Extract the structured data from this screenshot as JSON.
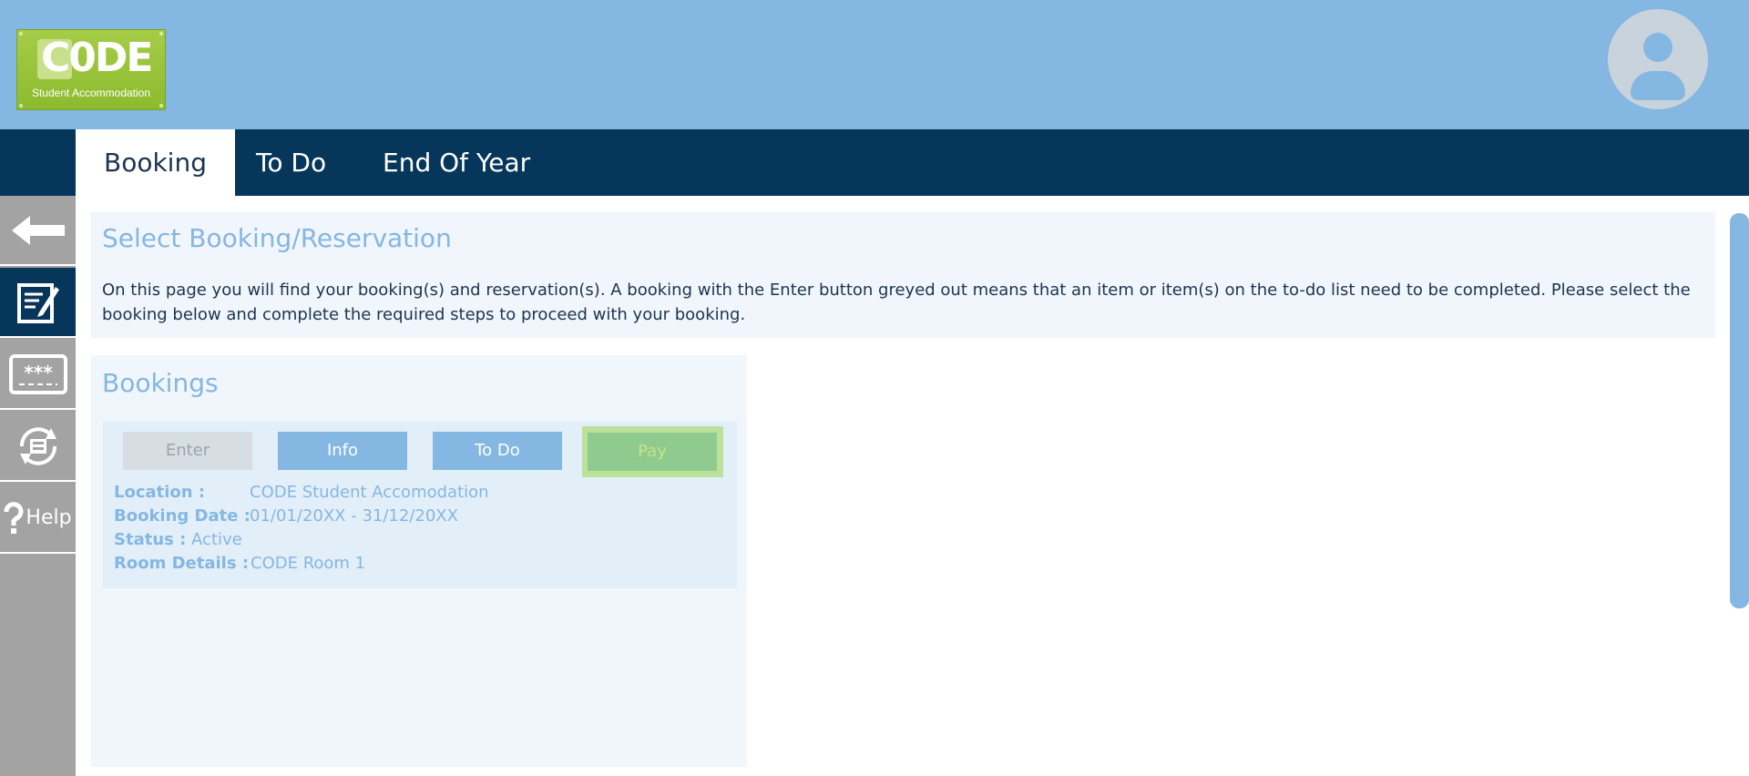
{
  "header": {
    "logo_text": "C0DE",
    "logo_tagline": "Student Accommodation"
  },
  "nav": {
    "tabs": [
      {
        "label": "Booking",
        "active": true
      },
      {
        "label": "To Do",
        "active": false
      },
      {
        "label": "End Of Year",
        "active": false
      }
    ]
  },
  "sidebar": {
    "items": [
      {
        "icon": "back-arrow-icon"
      },
      {
        "icon": "edit-document-icon",
        "active": true
      },
      {
        "icon": "password-icon"
      },
      {
        "icon": "refresh-print-icon"
      },
      {
        "icon": "help-icon",
        "label": "Help"
      }
    ]
  },
  "intro": {
    "title": "Select Booking/Reservation",
    "text": "On this page you will find your booking(s) and reservation(s). A booking with the Enter button greyed out means that an item or item(s) on the to-do list need to be completed. Please select the booking below and complete the required steps to proceed with your booking."
  },
  "bookings": {
    "title": "Bookings",
    "buttons": {
      "enter": "Enter",
      "info": "Info",
      "todo": "To Do",
      "pay": "Pay"
    },
    "details": {
      "location_label": "Location :",
      "location_value": "CODE Student Accomodation",
      "date_label": "Booking Date :",
      "date_value": "01/01/20XX - 31/12/20XX",
      "status_label": "Status :",
      "status_value": "Active",
      "room_label": "Room Details :",
      "room_value": "CODE Room 1"
    }
  },
  "colors": {
    "header_bg": "#84b7e2",
    "nav_bg": "#06365a",
    "sidebar_bg": "#a3a3a3",
    "logo_green": "#a6cc48",
    "accent_text": "#84b7e2",
    "body_text": "#1c3550",
    "pay_highlight": "#bce199"
  }
}
